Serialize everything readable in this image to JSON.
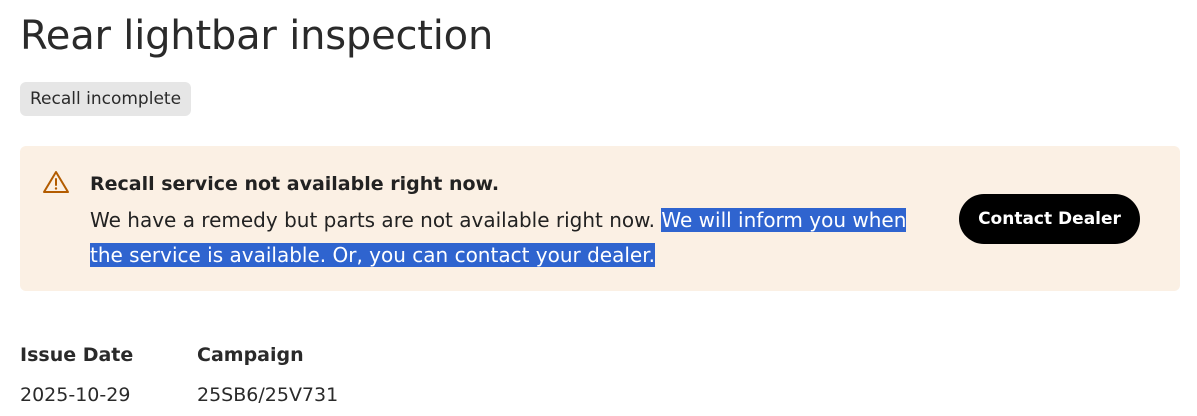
{
  "page": {
    "title": "Rear lightbar inspection",
    "status_badge": "Recall incomplete"
  },
  "alert": {
    "icon": "warning-triangle-icon",
    "icon_color": "#b35c00",
    "background_color": "#fbf0e4",
    "heading": "Recall service not available right now.",
    "body_plain": "We have a remedy but parts are not available right now. ",
    "body_selected": "We will inform you when the service is available. Or, you can contact your dealer.",
    "selection_color": "#2f64cf",
    "button_label": "Contact Dealer"
  },
  "details": {
    "issue_date_label": "Issue Date",
    "issue_date_value": "2025-10-29",
    "campaign_label": "Campaign",
    "campaign_value": "25SB6/25V731"
  }
}
